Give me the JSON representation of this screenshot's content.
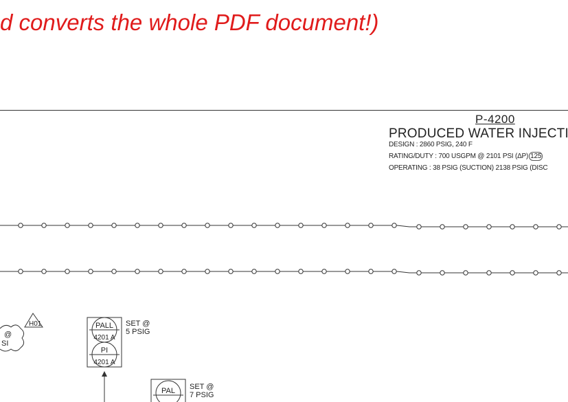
{
  "caption": "d converts the whole PDF document!)",
  "equipment": {
    "tag": "P-4200",
    "name": "PRODUCED WATER INJECTION",
    "design": "DESIGN : 2860 PSIG, 240 F",
    "rating": "RATING/DUTY : 700 USGPM @ 2101 PSI (ΔP)",
    "rating_cloud": "125",
    "operating": "OPERATING : 38 PSIG (SUCTION) 2138 PSIG (DISC"
  },
  "instruments": {
    "pall": {
      "tag": "PALL",
      "number": "4201 A",
      "setpoint_label": "SET @",
      "setpoint_value": "5 PSIG"
    },
    "pi": {
      "tag": "PI",
      "number": "4201 A"
    },
    "pal": {
      "tag": "PAL",
      "setpoint_label": "SET @",
      "setpoint_value": "7 PSIG"
    },
    "hold_flag": "H01",
    "cloud_text_1": "@",
    "cloud_text_2": "SI"
  },
  "colors": {
    "caption": "#e01b1b",
    "lines": "#333333"
  }
}
